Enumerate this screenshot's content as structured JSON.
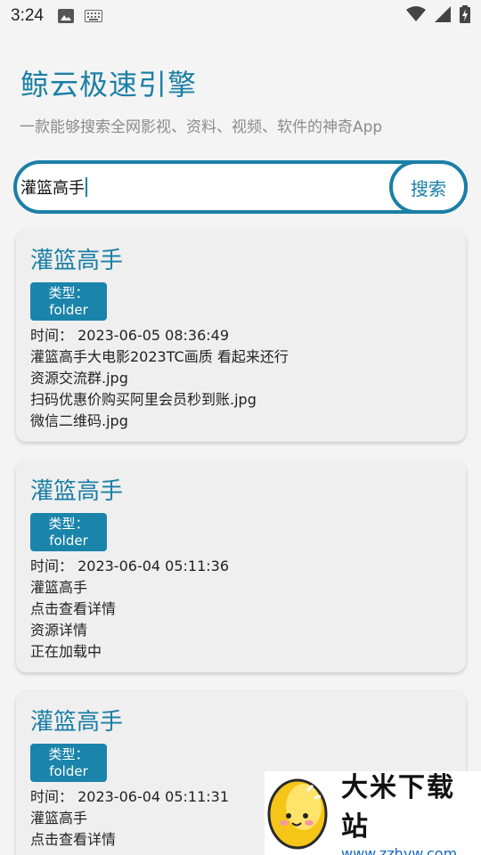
{
  "status_bar": {
    "time": "3:24",
    "icons": [
      "image-icon",
      "keyboard-icon",
      "wifi-icon",
      "signal-icon",
      "battery-icon"
    ]
  },
  "header": {
    "title": "鲸云极速引擎",
    "subtitle": "一款能够搜索全网影视、资料、视频、软件的神奇App"
  },
  "search": {
    "value": "灌篮高手",
    "button_label": "搜索"
  },
  "results": [
    {
      "title": "灌篮高手",
      "type_label": "类型：",
      "type_value": "folder",
      "time": "时间：  2023-06-05 08:36:49",
      "lines": [
        "灌篮高手大电影2023TC画质 看起来还行",
        "资源交流群.jpg",
        "扫码优惠价购买阿里会员秒到账.jpg",
        "微信二维码.jpg"
      ]
    },
    {
      "title": "灌篮高手",
      "type_label": "类型：",
      "type_value": "folder",
      "time": "时间：  2023-06-04 05:11:36",
      "lines": [
        "灌篮高手",
        "点击查看详情",
        "资源详情",
        "正在加载中"
      ]
    },
    {
      "title": "灌篮高手",
      "type_label": "类型：",
      "type_value": "folder",
      "time": "时间：  2023-06-04 05:11:31",
      "lines": [
        "灌篮高手",
        "点击查看详情"
      ]
    }
  ],
  "watermark": {
    "name": "大米下载站",
    "url": "www.zzhyw.com"
  },
  "colors": {
    "accent": "#1b7fa6",
    "badge": "#1b84ab",
    "card_bg": "#efefef"
  }
}
